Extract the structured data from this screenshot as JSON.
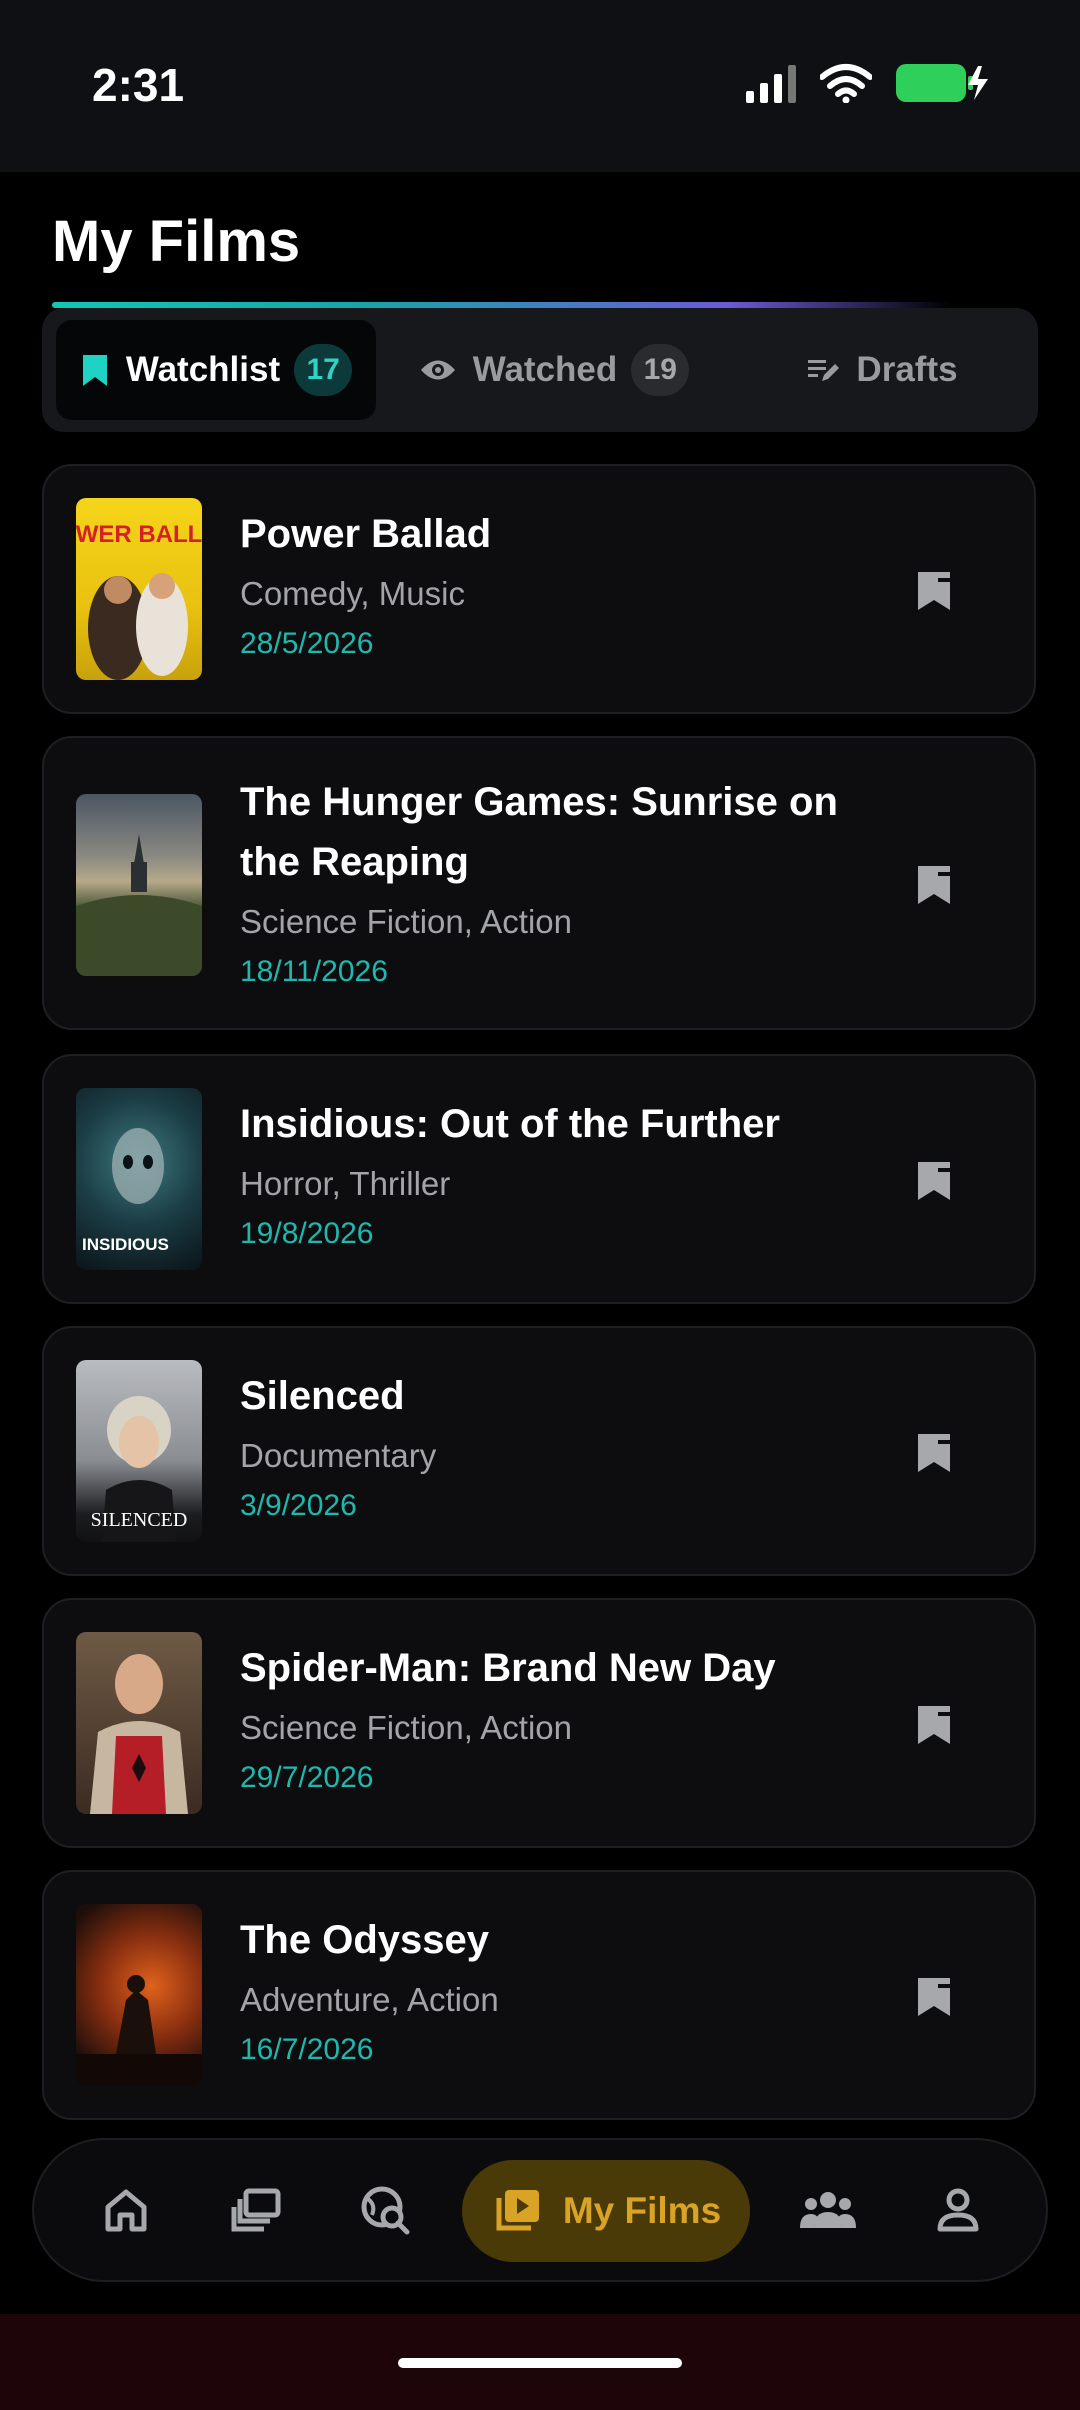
{
  "status_bar": {
    "time": "2:31"
  },
  "header": {
    "title": "My Films"
  },
  "tabs": [
    {
      "label": "Watchlist",
      "count": "17",
      "active": true,
      "icon": "bookmark-icon"
    },
    {
      "label": "Watched",
      "count": "19",
      "active": false,
      "icon": "eye-icon"
    },
    {
      "label": "Drafts",
      "active": false,
      "icon": "edit-list-icon"
    }
  ],
  "films": [
    {
      "title": "Power Ballad",
      "genres": "Comedy, Music",
      "date": "28/5/2026",
      "poster_text": "POWER BALLAD"
    },
    {
      "title": "The Hunger Games: Sunrise on the Reaping",
      "genres": "Science Fiction, Action",
      "date": "18/11/2026"
    },
    {
      "title": "Insidious: Out of the Further",
      "genres": "Horror, Thriller",
      "date": "19/8/2026",
      "poster_text": "INSIDIOUS"
    },
    {
      "title": "Silenced",
      "genres": "Documentary",
      "date": "3/9/2026",
      "poster_text": "SILENCED"
    },
    {
      "title": "Spider-Man: Brand New Day",
      "genres": "Science Fiction, Action",
      "date": "29/7/2026"
    },
    {
      "title": "The Odyssey",
      "genres": "Adventure, Action",
      "date": "16/7/2026"
    }
  ],
  "bottom_nav": {
    "items": [
      "home-icon",
      "collections-icon",
      "discover-icon",
      "my-films-icon",
      "friends-icon",
      "profile-icon"
    ],
    "active_label": "My Films"
  },
  "colors": {
    "accent_teal": "#1fb8ad",
    "nav_active_gold": "#d9a325",
    "card_bg": "#0d0d0f"
  }
}
